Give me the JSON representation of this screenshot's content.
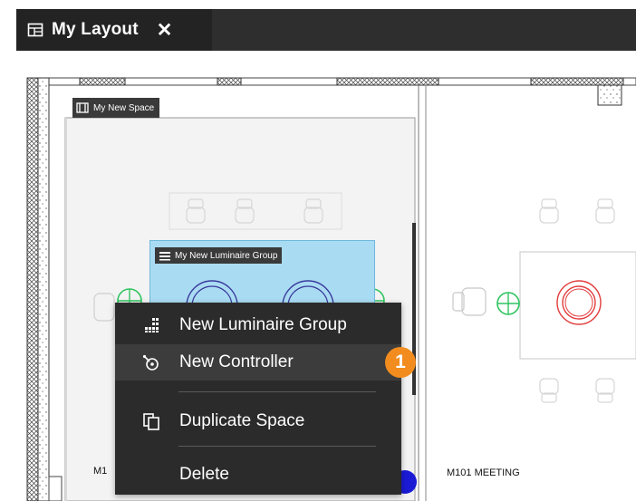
{
  "tab": {
    "title": "My Layout",
    "close_glyph": "✕",
    "icon": "layout-icon"
  },
  "space": {
    "label": "My New Space",
    "icon": "space-icon"
  },
  "luminaire_group": {
    "label": "My New Luminaire Group",
    "icon": "luminaire-group-icon"
  },
  "rooms": [
    {
      "label": "M1"
    },
    {
      "label": "M101 MEETING"
    }
  ],
  "context_menu": {
    "items": [
      {
        "label": "New Luminaire Group",
        "icon": "luminaire-group-icon"
      },
      {
        "label": "New Controller",
        "icon": "controller-icon",
        "highlighted": true
      },
      {
        "label": "Duplicate Space",
        "icon": "duplicate-icon"
      },
      {
        "label": "Delete",
        "icon": ""
      }
    ]
  },
  "callout": {
    "number": "1"
  },
  "colors": {
    "tab_bg": "#232323",
    "menu_bg": "#2b2b2b",
    "group_fill": "#a9dcf3",
    "callout": "#f28c1f",
    "luminaire_red": "#e23b3b",
    "sensor_green": "#22c35a"
  }
}
